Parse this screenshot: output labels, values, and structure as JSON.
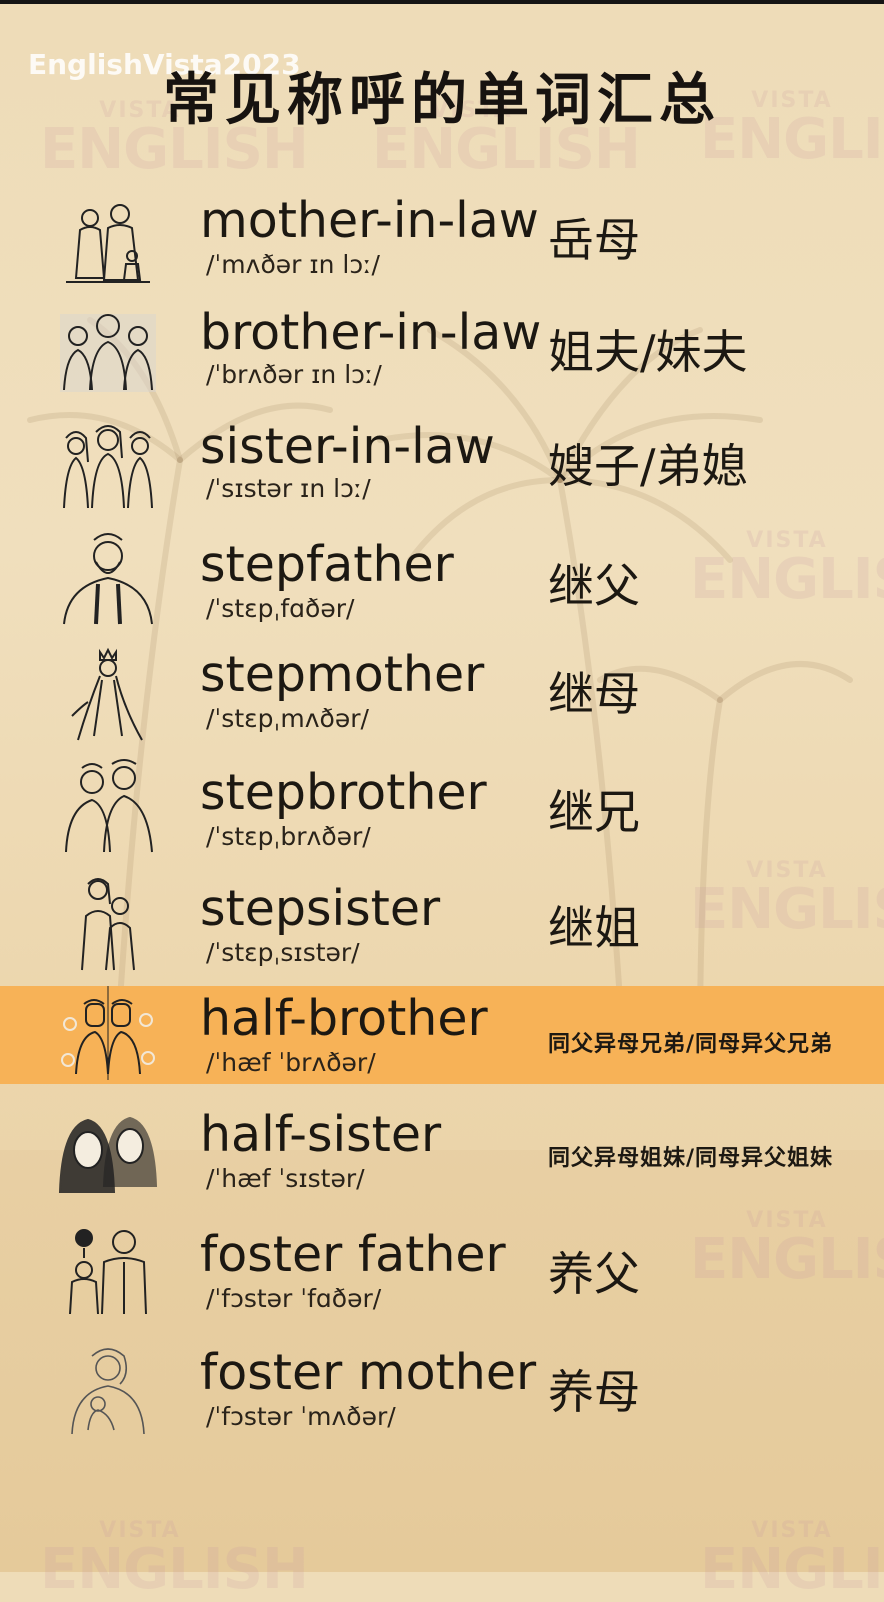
{
  "channel_mark": "EnglishVista2023",
  "title": "常见称呼的单词汇总",
  "watermark": {
    "top": "VISTA",
    "bottom": "ENGLISH"
  },
  "entries": [
    {
      "word": "mother-in-law",
      "ipa": "/ˈmʌðər ɪn lɔː/",
      "meaning": "岳母",
      "icon": "two-women-icon"
    },
    {
      "word": "brother-in-law",
      "ipa": "/ˈbrʌðər ɪn lɔː/",
      "meaning": "姐夫/妹夫",
      "icon": "three-men-icon"
    },
    {
      "word": "sister-in-law",
      "ipa": "/ˈsɪstər ɪn lɔː/",
      "meaning": "嫂子/弟媳",
      "icon": "three-women-icon"
    },
    {
      "word": "stepfather",
      "ipa": "/ˈstɛpˌfɑðər/",
      "meaning": "继父",
      "icon": "bearded-man-icon"
    },
    {
      "word": "stepmother",
      "ipa": "/ˈstɛpˌmʌðər/",
      "meaning": "继母",
      "icon": "queen-icon"
    },
    {
      "word": "stepbrother",
      "ipa": "/ˈstɛpˌbrʌðər/",
      "meaning": "继兄",
      "icon": "two-boys-icon"
    },
    {
      "word": "stepsister",
      "ipa": "/ˈstɛpˌsɪstər/",
      "meaning": "继姐",
      "icon": "two-girls-icon"
    },
    {
      "word": "half-brother",
      "ipa": "/ˈhæf ˈbrʌðər/",
      "meaning": "同父异母兄弟/同母异父兄弟",
      "icon": "twin-men-icon"
    },
    {
      "word": "half-sister",
      "ipa": "/ˈhæf ˈsɪstər/",
      "meaning": "同父异母姐妹/同母异父姐妹",
      "icon": "two-women-faces-icon"
    },
    {
      "word": "foster father",
      "ipa": "/ˈfɔstər ˈfɑðər/",
      "meaning": "养父",
      "icon": "father-child-icon"
    },
    {
      "word": "foster mother",
      "ipa": "/ˈfɔstər ˈmʌðər/",
      "meaning": "养母",
      "icon": "mother-child-icon"
    }
  ],
  "colors": {
    "background": "#eedcb8",
    "highlight": "#f7b257",
    "text": "#1b1712"
  }
}
